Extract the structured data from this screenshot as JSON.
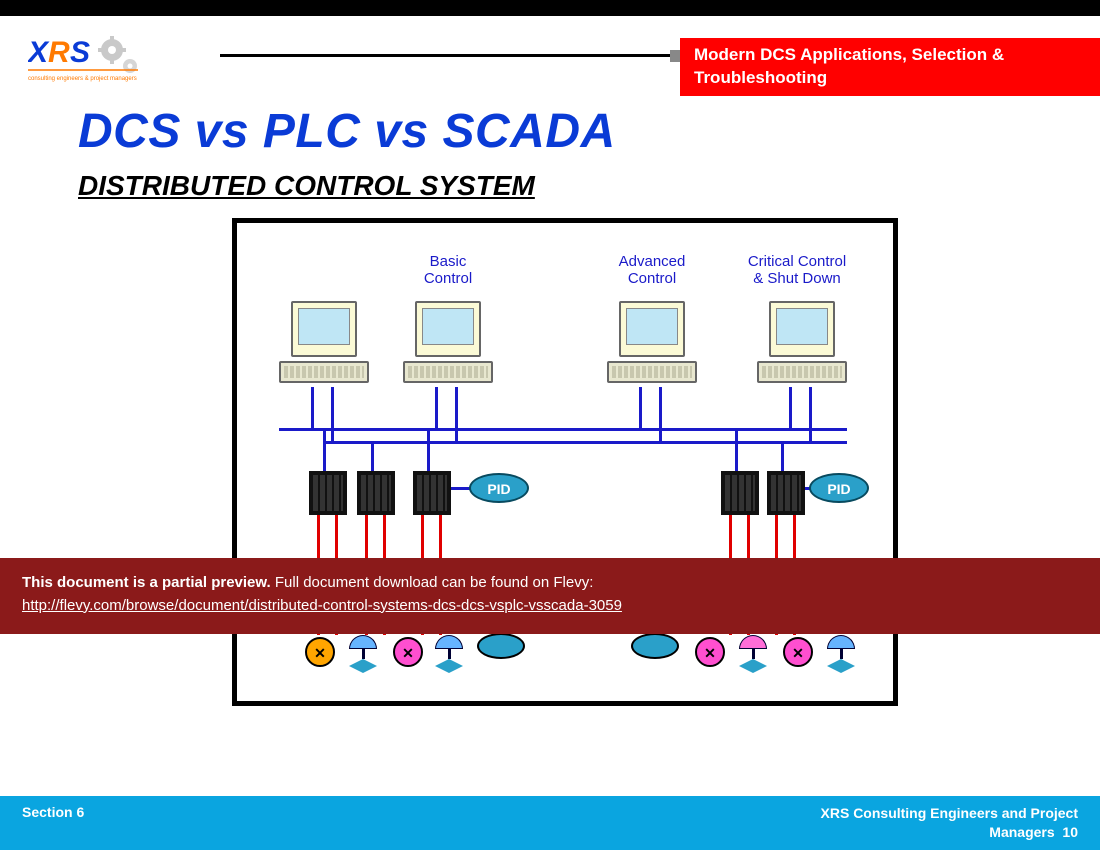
{
  "header": {
    "logo_text_main": "XRS",
    "logo_text_sub": "consulting engineers & project managers",
    "banner_title": "Modern DCS Applications, Selection & Troubleshooting"
  },
  "titles": {
    "main": "DCS vs PLC vs SCADA",
    "sub": "DISTRIBUTED CONTROL SYSTEM"
  },
  "diagram": {
    "labels": {
      "basic": "Basic\nControl",
      "advanced": "Advanced\nControl",
      "critical": "Critical Control\n& Shut Down"
    },
    "pid_label": "PID"
  },
  "preview": {
    "bold": "This document is a partial preview.",
    "rest": "  Full document download can be found on Flevy:",
    "url_text": "http://flevy.com/browse/document/distributed-control-systems-dcs-dcs-vsplc-vsscada-3059"
  },
  "footer": {
    "left": "Section 6",
    "right_org": "XRS Consulting Engineers and Project",
    "right_line2": "Managers",
    "page_no": "10"
  }
}
